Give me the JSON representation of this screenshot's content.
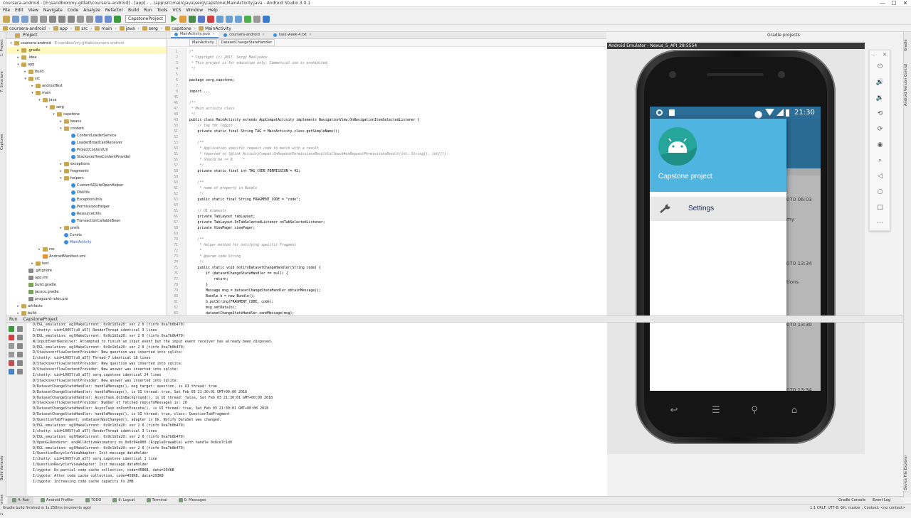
{
  "window": {
    "title": "coursera-android - [E:\\sandbox\\my-gitlab\\coursera-android] - [app] - ...\\app\\src\\main\\java\\serg\\capstone\\MainActivity.java - Android Studio 3.0.1",
    "minimize": "—",
    "maximize": "☐",
    "close": "✕"
  },
  "menu": [
    "File",
    "Edit",
    "View",
    "Navigate",
    "Code",
    "Analyze",
    "Refactor",
    "Build",
    "Run",
    "Tools",
    "VCS",
    "Window",
    "Help"
  ],
  "toolbar": {
    "run_config": "CapstoneProject"
  },
  "breadcrumb": [
    "coursera-android",
    "app",
    "src",
    "main",
    "java",
    "serg",
    "capstone",
    "MainActivity"
  ],
  "project_panel": {
    "title": "Project",
    "tree": [
      {
        "label": "coursera-android",
        "extra": "E:\\sandbox\\my-gitlab\\coursera-android",
        "depth": 0,
        "icon": "f",
        "open": true
      },
      {
        "label": ".gradle",
        "depth": 1,
        "icon": "f",
        "open": false,
        "selected": true
      },
      {
        "label": ".idea",
        "depth": 1,
        "icon": "f",
        "open": false
      },
      {
        "label": "app",
        "depth": 1,
        "icon": "f",
        "open": true
      },
      {
        "label": "build",
        "depth": 2,
        "icon": "f",
        "open": false
      },
      {
        "label": "src",
        "depth": 2,
        "icon": "f",
        "open": true
      },
      {
        "label": "androidTest",
        "depth": 3,
        "icon": "f",
        "open": false
      },
      {
        "label": "main",
        "depth": 3,
        "icon": "f",
        "open": true
      },
      {
        "label": "java",
        "depth": 4,
        "icon": "f",
        "open": true
      },
      {
        "label": "serg",
        "depth": 5,
        "icon": "f",
        "open": true
      },
      {
        "label": "capstone",
        "depth": 6,
        "icon": "f",
        "open": true
      },
      {
        "label": "beans",
        "depth": 7,
        "icon": "f",
        "open": false
      },
      {
        "label": "content",
        "depth": 7,
        "icon": "f",
        "open": true
      },
      {
        "label": "ContentLoaderService",
        "depth": 8,
        "icon": "c"
      },
      {
        "label": "LoaderBroadcastReceiver",
        "depth": 8,
        "icon": "c"
      },
      {
        "label": "ProjectContentUri",
        "depth": 8,
        "icon": "c"
      },
      {
        "label": "StackoverflowContentProvider",
        "depth": 8,
        "icon": "c"
      },
      {
        "label": "exceptions",
        "depth": 7,
        "icon": "f",
        "open": false
      },
      {
        "label": "fragments",
        "depth": 7,
        "icon": "f",
        "open": false
      },
      {
        "label": "helpers",
        "depth": 7,
        "icon": "f",
        "open": true
      },
      {
        "label": "CustomSQLiteOpenHelper",
        "depth": 8,
        "icon": "c"
      },
      {
        "label": "DbUtils",
        "depth": 8,
        "icon": "c"
      },
      {
        "label": "ExceptionUtils",
        "depth": 8,
        "icon": "c"
      },
      {
        "label": "PermissionsHelper",
        "depth": 8,
        "icon": "c"
      },
      {
        "label": "ResourceUtils",
        "depth": 8,
        "icon": "c"
      },
      {
        "label": "TransactionCallableBean",
        "depth": 8,
        "icon": "c"
      },
      {
        "label": "prefs",
        "depth": 7,
        "icon": "f",
        "open": false
      },
      {
        "label": "Consts",
        "depth": 7,
        "icon": "c"
      },
      {
        "label": "MainActivity",
        "depth": 7,
        "icon": "c",
        "active": true
      },
      {
        "label": "res",
        "depth": 4,
        "icon": "f",
        "open": false
      },
      {
        "label": "AndroidManifest.xml",
        "depth": 4,
        "icon": "x"
      },
      {
        "label": "test",
        "depth": 3,
        "icon": "f",
        "open": false
      },
      {
        "label": ".gitignore",
        "depth": 2,
        "icon": "m"
      },
      {
        "label": "app.iml",
        "depth": 2,
        "icon": "m"
      },
      {
        "label": "build.gradle",
        "depth": 2,
        "icon": "g"
      },
      {
        "label": "jacoco.gradle",
        "depth": 2,
        "icon": "g"
      },
      {
        "label": "proguard-rules.pro",
        "depth": 2,
        "icon": "m"
      },
      {
        "label": "artifacts",
        "depth": 1,
        "icon": "f",
        "open": false
      },
      {
        "label": "build",
        "depth": 1,
        "icon": "f",
        "open": false
      }
    ]
  },
  "editor": {
    "tabs": [
      {
        "label": "MainActivity.java",
        "active": true
      },
      {
        "label": "coursera-android",
        "active": false
      },
      {
        "label": "task-week-4.txt",
        "active": false
      }
    ],
    "crumbs": [
      "MainActivity",
      "DatasetChangeStateHandler"
    ],
    "lines": [
      {
        "n": "1",
        "t": "/*",
        "c": "cm"
      },
      {
        "n": "2",
        "t": " * Copyright (c) 2017. Sergy Maslyukov.",
        "c": "cm"
      },
      {
        "n": "3",
        "t": " * This project is for education only. Commercial use is prohibited.",
        "c": "cm"
      },
      {
        "n": "4",
        "t": " */",
        "c": "cm"
      },
      {
        "n": "5",
        "t": "",
        "c": ""
      },
      {
        "n": "6",
        "t": "package serg.capstone;",
        "c": "pk"
      },
      {
        "n": "7",
        "t": "",
        "c": ""
      },
      {
        "n": "8",
        "t": "import ...",
        "c": "im"
      },
      {
        "n": "45",
        "t": "",
        "c": ""
      },
      {
        "n": "46",
        "t": "/**",
        "c": "cm"
      },
      {
        "n": "47",
        "t": " * Main activity class",
        "c": "cm"
      },
      {
        "n": "48",
        "t": " */",
        "c": "cm"
      },
      {
        "n": "49",
        "t": "public class MainActivity extends AppCompatActivity implements NavigationView.OnNavigationItemSelectedListener {",
        "c": "cls"
      },
      {
        "n": "50",
        "t": "    // tag for loggin",
        "c": "cm"
      },
      {
        "n": "51",
        "t": "    private static final String TAG = MainActivity.class.getSimpleName();",
        "c": "tag"
      },
      {
        "n": "52",
        "t": "",
        "c": ""
      },
      {
        "n": "53",
        "t": "    /**",
        "c": "cm"
      },
      {
        "n": "54",
        "t": "     * Application specific request code to match with a result",
        "c": "cm"
      },
      {
        "n": "55",
        "t": "     * reported to {@link ActivityCompat.OnRequestPermissionsResultCallback#onRequestPermissionsResult(int, String[], int[])}.",
        "c": "cm"
      },
      {
        "n": "56",
        "t": "     * Should be >= 0.    *",
        "c": "cm"
      },
      {
        "n": "57",
        "t": "     */",
        "c": "cm"
      },
      {
        "n": "58",
        "t": "    private static final int TAG_CODE_PERMISSION = 42;",
        "c": "perm"
      },
      {
        "n": "59",
        "t": "",
        "c": ""
      },
      {
        "n": "60",
        "t": "    /**",
        "c": "cm"
      },
      {
        "n": "61",
        "t": "     * name of property in Bundle",
        "c": "cm"
      },
      {
        "n": "62",
        "t": "     */",
        "c": "cm"
      },
      {
        "n": "63",
        "t": "    public static final String FRAGMENT_CODE = \"code\";",
        "c": "frag"
      },
      {
        "n": "64",
        "t": "",
        "c": ""
      },
      {
        "n": "65",
        "t": "    // UI elements",
        "c": "cm"
      },
      {
        "n": "66",
        "t": "    private TabLayout tabLayout;",
        "c": "tl"
      },
      {
        "n": "67",
        "t": "    private TabLayout.OnTabSelectedListener onTabSelectedListener;",
        "c": "tsl"
      },
      {
        "n": "68",
        "t": "    private ViewPager viewPager;",
        "c": "vp"
      },
      {
        "n": "69",
        "t": "",
        "c": ""
      },
      {
        "n": "70",
        "t": "    /**",
        "c": "cm"
      },
      {
        "n": "71",
        "t": "     * helper method for notifying specific Fragment",
        "c": "cm"
      },
      {
        "n": "72",
        "t": "     *",
        "c": "cm"
      },
      {
        "n": "73",
        "t": "     * @param code String",
        "c": "cm"
      },
      {
        "n": "74",
        "t": "     */",
        "c": "cm"
      },
      {
        "n": "75",
        "t": "    public static void notifyDatasetChangeHandler(String code) {",
        "c": "m"
      },
      {
        "n": "76",
        "t": "        if (datasetChangeStateHandler == null) {",
        "c": "if"
      },
      {
        "n": "77",
        "t": "            return;",
        "c": "ret"
      },
      {
        "n": "78",
        "t": "        }",
        "c": ""
      },
      {
        "n": "79",
        "t": "        Message msg = datasetChangeStateHandler.obtainMessage();",
        "c": "msg"
      },
      {
        "n": "80",
        "t": "        Bundle b = new Bundle();",
        "c": "new"
      },
      {
        "n": "81",
        "t": "        b.putString(FRAGMENT_CODE, code);",
        "c": "put"
      },
      {
        "n": "82",
        "t": "        msg.setData(b);",
        "c": ""
      },
      {
        "n": "83",
        "t": "        datasetChangeStateHandler.sendMessage(msg);",
        "c": "send"
      }
    ]
  },
  "gradle_tab": "Gradle projects",
  "emulator": {
    "title": "Android Emulator - Nexus_5_API_28:5554",
    "time": "21:30",
    "drawer_title": "Capstone project",
    "menu_item": "Settings",
    "behind": [
      {
        "text": "070 06:03"
      },
      {
        "text": "my"
      },
      {
        "text": "070 13:34"
      },
      {
        "text": "tions"
      },
      {
        "text": "070 13:30"
      },
      {
        "text": "070 13:34"
      }
    ],
    "controls": [
      "power-icon",
      "volume-up-icon",
      "volume-down-icon",
      "rotate-left-icon",
      "rotate-right-icon",
      "camera-icon",
      "zoom-icon",
      "back-icon",
      "home-icon",
      "overview-icon",
      "more-icon"
    ]
  },
  "run_panel": {
    "title": "Run",
    "config": "CapstoneProject",
    "log": [
      "D/EGL_emulation: eglMakeCurrent: 0x9c1b5a20: ver 2 0 (tinfo 0xa7b0b470)",
      "I/chatty: uid=10057(u0_a57) RenderThread identical 3 lines",
      "D/EGL_emulation: eglMakeCurrent: 0x9c1b5a20: ver 2 0 (tinfo 0xa7b0b470)",
      "W/InputEventReceiver: Attempted to finish an input event but the input event receiver has already been disposed.",
      "D/EGL_emulation: eglMakeCurrent: 0x9c1b5a20: ver 2 0 (tinfo 0xa7b0b470)",
      "D/StackoverflowContentProvider: New question was inserted into sqlite:",
      "I/chatty: uid=10057(u0_a57) Thread-7 identical 18 lines",
      "D/StackoverflowContentProvider: New question was inserted into sqlite:",
      "D/StackoverflowContentProvider: New answer was inserted into sqlite:",
      "I/chatty: uid=10057(u0_a57) serg.capstone identical 24 lines",
      "D/StackoverflowContentProvider: New answer was inserted into sqlite:",
      "D/DatasetChangeStateHandler: handleMessage(), msg target: question. is UI thread: true",
      "D/DatasetChangeStateHandler: handleMessage(), is UI thread: true, Sat Feb 03 21:30:01 GMT+00:00 2018",
      "D/DatasetChangeStateHandler: AsyncTask.doInBackground(), is UI thread: false, Sat Feb 03 21:30:01 GMT+00:00 2018",
      "D/StackoverflowContentProvider: Number of fetched replyToMessages is: 20",
      "D/DatasetChangeStateHandler: AsyncTask.onPostExecute(), is UI thread: true, Sat Feb 03 21:30:01 GMT+00:00 2018",
      "D/DatasetChangeStateHandler: handleMessage(), is UI thread: true, class: QuestionTabFragment",
      "D/QuestionTabFragment: onDatasetWasChanged(), adapter is Ok. Notify DataSet was changed.",
      "D/EGL_emulation: eglMakeCurrent: 0x9c1b5a20: ver 2 0 (tinfo 0xa7b0b470)",
      "I/chatty: uid=10057(u0_a57) RenderThread identical 3 lines",
      "D/EGL_emulation: eglMakeCurrent: 0x9c1b5a20: ver 2 0 (tinfo 0xa7b0b470)",
      "D/OpenGLRenderer: endAllActiveAnimators on 0x8c04e000 (RippleDrawable) with handle 0x8ce7c1d0",
      "D/EGL_emulation: eglMakeCurrent: 0x9c1b5a20: ver 2 0 (tinfo 0xa7b0b470)",
      "I/QuestionRecyclerViewAdapter: Init message dataHolder",
      "I/chatty: uid=10057(u0_a57) serg.capstone identical 1 line",
      "I/QuestionRecyclerViewAdapter: Init message dataHolder",
      "I/zygote: Do partial code cache collection, code=458KB, data=294KB",
      "I/zygote: After code cache collection, code=458KB, data=293KB",
      "I/zygote: Increasing code cache capacity to 2MB"
    ]
  },
  "bottom_tabs": [
    {
      "label": "4: Run",
      "active": true
    },
    {
      "label": "Android Profiler"
    },
    {
      "label": "TODO"
    },
    {
      "label": "6: Logcat"
    },
    {
      "label": "Terminal"
    },
    {
      "label": "0: Messages"
    }
  ],
  "bottom_right_tabs": [
    "Gradle Console",
    "Event Log"
  ],
  "status": {
    "left": "Gradle build finished in 1s 258ms (moments ago)",
    "right": "1:1   CRLF:   UTF-8:   Git: master :   Context: <no context>"
  },
  "side_left": [
    "1: Project",
    "7: Structure",
    "Captures",
    "Build Variants",
    "2: Favorites"
  ],
  "side_right": [
    "Gradle",
    "Android Version Control",
    "Device File Explorer"
  ]
}
